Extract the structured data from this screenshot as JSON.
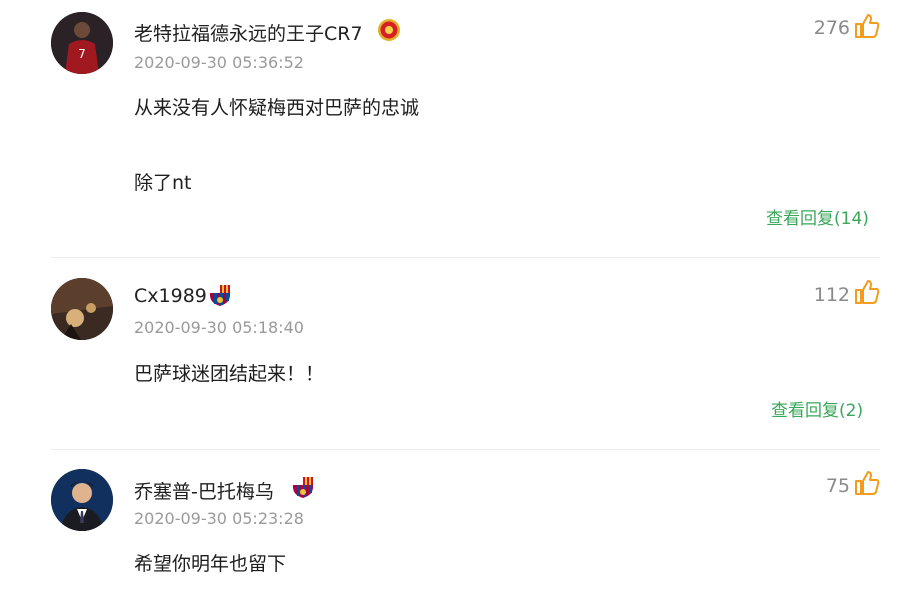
{
  "comments": [
    {
      "username": "老特拉福德永远的王子CR7",
      "badge": "manchester-united-badge",
      "time": "2020-09-30 05:36:52",
      "likes": "276",
      "lines": [
        "从来没有人怀疑梅西对巴萨的忠诚",
        "除了nt"
      ],
      "reply": "查看回复(14)"
    },
    {
      "username": "Cx1989",
      "badge": "fc-barcelona-badge",
      "time": "2020-09-30 05:18:40",
      "likes": "112",
      "lines": [
        "巴萨球迷团结起来！！"
      ],
      "reply": "查看回复(2)"
    },
    {
      "username": "乔塞普-巴托梅乌",
      "badge": "fc-barcelona-badge",
      "time": "2020-09-30 05:23:28",
      "likes": "75",
      "lines": [
        "希望你明年也留下"
      ]
    }
  ],
  "colors": {
    "reply_link": "#3aa65a",
    "like_icon": "#f39b1d",
    "time_text": "#9a9a9a"
  }
}
